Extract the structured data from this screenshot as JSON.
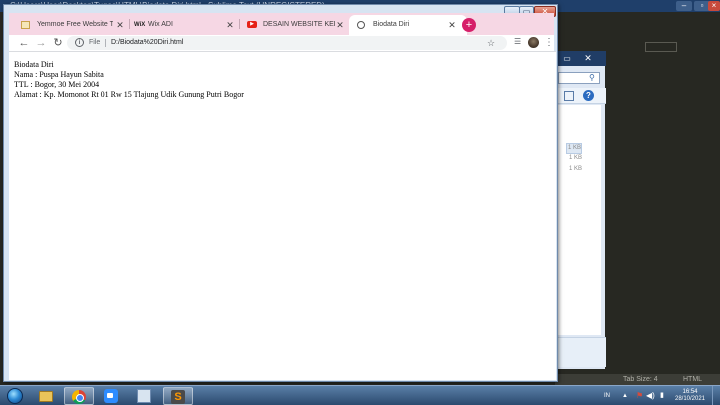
{
  "background_editor": {
    "title": "C:\\Users\\User\\Desktop\\Tugas\\HTML\\Biodata Diri.html - Sublime Text (UNREGISTERED)",
    "status_tab_size": "Tab Size: 4",
    "status_syntax": "HTML"
  },
  "background_explorer": {
    "file_sizes": [
      "1 KB",
      "1 KB",
      "1 KB"
    ]
  },
  "browser": {
    "tabs": [
      {
        "label": "Yemmoe Free Website Tem",
        "favicon": "folder-icon"
      },
      {
        "label": "Wix ADI",
        "favicon": "wix-icon",
        "favicon_text": "WiX"
      },
      {
        "label": "DESAIN WEBSITE KEREN",
        "favicon": "youtube-icon"
      },
      {
        "label": "Biodata Diri",
        "favicon": "globe-icon",
        "active": true
      }
    ],
    "address_bar": {
      "scheme_label": "File",
      "url": "D:/Biodata%20Diri.html"
    }
  },
  "page": {
    "lines": [
      "Biodata Diri",
      "Nama : Puspa Hayun Sabita",
      "TTL : Bogor, 30 Mei 2004",
      "Alamat : Kp. Momonot Rt 01 Rw 15 Tlajung Udik Gunung Putri Bogor"
    ]
  },
  "taskbar": {
    "apps": [
      "internet-explorer",
      "file-explorer",
      "chrome",
      "zoom",
      "calculator",
      "sublime-text"
    ],
    "tray": {
      "language": "IN",
      "time": "16:54",
      "date": "28/10/2021"
    }
  },
  "colors": {
    "tab_strip": "#f6d7e4",
    "new_tab_button": "#d61f69",
    "titlebar_dark": "#1f3f6a",
    "editor_bg": "#272822"
  }
}
